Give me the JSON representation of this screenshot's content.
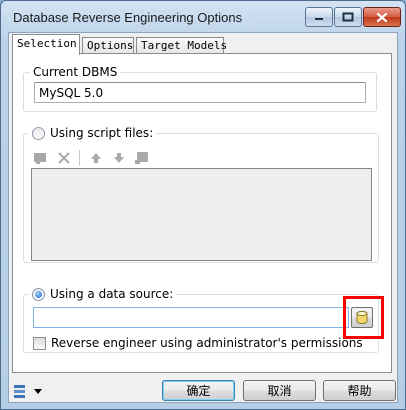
{
  "window": {
    "title": "Database Reverse Engineering Options"
  },
  "tabs": [
    {
      "label": "Selection",
      "active": true
    },
    {
      "label": "Options",
      "active": false
    },
    {
      "label": "Target Models",
      "active": false
    }
  ],
  "current_dbms": {
    "label": "Current DBMS",
    "value": "MySQL 5.0"
  },
  "script_files": {
    "label": "Using script files:",
    "selected": false,
    "toolbar_icons": [
      "add-file-icon",
      "delete-icon",
      "move-up-icon",
      "move-down-icon",
      "properties-icon"
    ]
  },
  "data_source": {
    "label": "Using a data source:",
    "selected": true,
    "value": "",
    "browse_icon": "database-cylinder-icon"
  },
  "admin_permissions": {
    "label": "Reverse engineer using administrator's permissions",
    "checked": false
  },
  "buttons": {
    "ok": "确定",
    "cancel": "取消",
    "help": "帮助"
  },
  "colors": {
    "highlight": "#ff0000",
    "radio_selected": "#1e64c8",
    "close_button": "#c2391c"
  }
}
